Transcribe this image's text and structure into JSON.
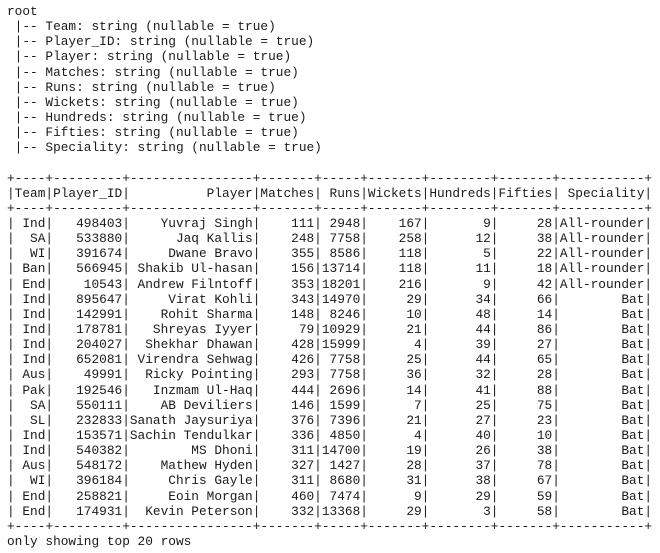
{
  "schema": {
    "root_label": "root",
    "fields": [
      {
        "name": "Team",
        "type": "string",
        "nullable": "true"
      },
      {
        "name": "Player_ID",
        "type": "string",
        "nullable": "true"
      },
      {
        "name": "Player",
        "type": "string",
        "nullable": "true"
      },
      {
        "name": "Matches",
        "type": "string",
        "nullable": "true"
      },
      {
        "name": "Runs",
        "type": "string",
        "nullable": "true"
      },
      {
        "name": "Wickets",
        "type": "string",
        "nullable": "true"
      },
      {
        "name": "Hundreds",
        "type": "string",
        "nullable": "true"
      },
      {
        "name": "Fifties",
        "type": "string",
        "nullable": "true"
      },
      {
        "name": "Speciality",
        "type": "string",
        "nullable": "true"
      }
    ]
  },
  "table": {
    "columns": [
      "Team",
      "Player_ID",
      "Player",
      "Matches",
      "Runs",
      "Wickets",
      "Hundreds",
      "Fifties",
      "Speciality"
    ],
    "rows": [
      [
        "Ind",
        "498403",
        "Yuvraj Singh",
        "111",
        "2948",
        "167",
        "9",
        "28",
        "All-rounder"
      ],
      [
        "SA",
        "533880",
        "Jaq Kallis",
        "248",
        "7758",
        "258",
        "12",
        "38",
        "All-rounder"
      ],
      [
        "WI",
        "391674",
        "Dwane Bravo",
        "355",
        "8586",
        "118",
        "5",
        "22",
        "All-rounder"
      ],
      [
        "Ban",
        "566945",
        "Shakib Ul-hasan",
        "156",
        "13714",
        "118",
        "11",
        "18",
        "All-rounder"
      ],
      [
        "End",
        "10543",
        "Andrew Filntoff",
        "353",
        "18201",
        "216",
        "9",
        "42",
        "All-rounder"
      ],
      [
        "Ind",
        "895647",
        "Virat Kohli",
        "343",
        "14970",
        "29",
        "34",
        "66",
        "Bat"
      ],
      [
        "Ind",
        "142991",
        "Rohit Sharma",
        "148",
        "8246",
        "10",
        "48",
        "14",
        "Bat"
      ],
      [
        "Ind",
        "178781",
        "Shreyas Iyyer",
        "79",
        "10929",
        "21",
        "44",
        "86",
        "Bat"
      ],
      [
        "Ind",
        "204027",
        "Shekhar Dhawan",
        "428",
        "15999",
        "4",
        "39",
        "27",
        "Bat"
      ],
      [
        "Ind",
        "652081",
        "Virendra Sehwag",
        "426",
        "7758",
        "25",
        "44",
        "65",
        "Bat"
      ],
      [
        "Aus",
        "49991",
        "Ricky Pointing",
        "293",
        "7758",
        "36",
        "32",
        "28",
        "Bat"
      ],
      [
        "Pak",
        "192546",
        "Inzmam Ul-Haq",
        "444",
        "2696",
        "14",
        "41",
        "88",
        "Bat"
      ],
      [
        "SA",
        "550111",
        "AB Deviliers",
        "146",
        "1599",
        "7",
        "25",
        "75",
        "Bat"
      ],
      [
        "SL",
        "232833",
        "Sanath Jaysuriya",
        "376",
        "7396",
        "21",
        "27",
        "23",
        "Bat"
      ],
      [
        "Ind",
        "153571",
        "Sachin Tendulkar",
        "336",
        "4850",
        "4",
        "40",
        "10",
        "Bat"
      ],
      [
        "Ind",
        "540382",
        "MS Dhoni",
        "311",
        "14700",
        "19",
        "26",
        "38",
        "Bat"
      ],
      [
        "Aus",
        "548172",
        "Mathew Hyden",
        "327",
        "1427",
        "28",
        "37",
        "78",
        "Bat"
      ],
      [
        "WI",
        "396184",
        "Chris Gayle",
        "311",
        "8680",
        "31",
        "38",
        "67",
        "Bat"
      ],
      [
        "End",
        "258821",
        "Eoin Morgan",
        "460",
        "7474",
        "9",
        "29",
        "59",
        "Bat"
      ],
      [
        "End",
        "174931",
        "Kevin Peterson",
        "332",
        "13368",
        "29",
        "3",
        "58",
        "Bat"
      ]
    ],
    "footer": "only showing top 20 rows"
  }
}
